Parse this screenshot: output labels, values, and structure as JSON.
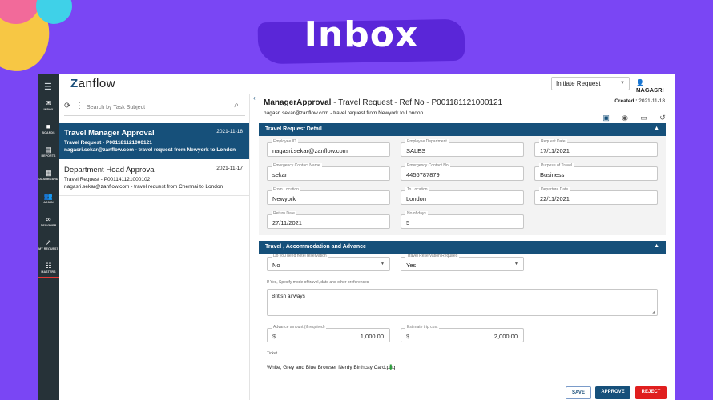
{
  "hero": {
    "title": "Inbox"
  },
  "app": {
    "logo": {
      "first": "Z",
      "rest": "anflow"
    },
    "initiate": {
      "label": "Initiate Request"
    },
    "user": {
      "name": "NAGASRI"
    },
    "rail": {
      "items": [
        {
          "label": "INBOX",
          "icon": "inbox-icon"
        },
        {
          "label": "BOARDS",
          "icon": "boards-icon"
        },
        {
          "label": "REPORTS",
          "icon": "reports-icon"
        },
        {
          "label": "DASHBOARD",
          "icon": "dashboard-icon"
        },
        {
          "label": "ADMIN",
          "icon": "admin-icon"
        },
        {
          "label": "DESIGNER",
          "icon": "designer-icon"
        },
        {
          "label": "MY REQUEST",
          "icon": "my-request-icon"
        },
        {
          "label": "MASTERS",
          "icon": "masters-icon"
        }
      ]
    },
    "list": {
      "search_placeholder": "Search by Task Subject",
      "items": [
        {
          "title": "Travel Manager Approval",
          "date": "2021-11-18",
          "line1": "Travel Request - P001181121000121",
          "line2": "nagasri.sekar@zanflow.com - travel request from Newyork to London"
        },
        {
          "title": "Department Head Approval",
          "date": "2021-11-17",
          "line1": "Travel Request - P001141121000102",
          "line2": "nagasri.sekar@zanflow.com - travel request from Chennai to London"
        }
      ]
    },
    "detail": {
      "title_bold": "ManagerApproval",
      "title_rest": " - Travel Request - Ref No - P001181121000121",
      "subtitle": "nagasri.sekar@zanflow.com - travel request from Newyork to London",
      "created_label": "Created :",
      "created_value": " 2021-11-18",
      "section1": {
        "title": "Travel Request Detail"
      },
      "fields": {
        "employee_id": {
          "label": "Employee ID",
          "value": "nagasri.sekar@zanflow.com"
        },
        "employee_department": {
          "label": "Employee Department",
          "value": "SALES"
        },
        "request_date": {
          "label": "Request Date",
          "value": "17/11/2021"
        },
        "emergency_name": {
          "label": "Emergency Contact Name",
          "value": "sekar"
        },
        "emergency_no": {
          "label": "Emergency Contact No",
          "value": "4456787879"
        },
        "purpose": {
          "label": "Purpose of Travel",
          "value": "Business"
        },
        "from_location": {
          "label": "From Location",
          "value": "Newyork"
        },
        "to_location": {
          "label": "To Location",
          "value": "London"
        },
        "departure_date": {
          "label": "Departure Date",
          "value": "22/11/2021"
        },
        "return_date": {
          "label": "Return Date",
          "value": "27/11/2021"
        },
        "no_of_days": {
          "label": "No of days",
          "value": "5"
        }
      },
      "section2": {
        "title": "Travel , Accommodation and Advance"
      },
      "hotel": {
        "label": "Do you need hotel reservation",
        "value": "No"
      },
      "travel_reservation": {
        "label": "Travel Reservation Required",
        "value": "Yes"
      },
      "mode_hint": "If Yes, Specify mode of travel, date and other preferences",
      "mode_value": "British airways",
      "advance": {
        "label": "Advance amount (if required)",
        "currency": "$",
        "value": "1,000.00"
      },
      "trip_cost": {
        "label": "Estimate trip cost",
        "currency": "$",
        "value": "2,000.00"
      },
      "ticket_label": "Ticket",
      "ticket_file": "White, Grey and Blue Browser Nerdy Birthcay Card.png",
      "buttons": {
        "save": "SAVE",
        "approve": "APPROVE",
        "reject": "REJECT"
      }
    }
  },
  "colors": {
    "background": "#7a46f4",
    "primary": "#16507a",
    "rail": "#263238",
    "reject": "#e01e1e"
  }
}
